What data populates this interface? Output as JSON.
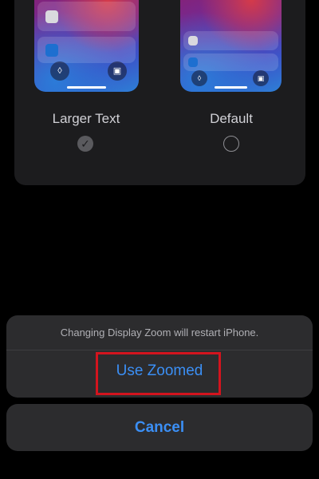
{
  "display_zoom": {
    "options": [
      {
        "label": "Larger Text",
        "selected": true
      },
      {
        "label": "Default",
        "selected": false
      }
    ],
    "preview_icons": {
      "left": "flashlight-icon",
      "right": "camera-icon"
    }
  },
  "action_sheet": {
    "message": "Changing Display Zoom will restart iPhone.",
    "primary_action": "Use Zoomed",
    "cancel": "Cancel"
  },
  "colors": {
    "accent": "#3b8ff5",
    "highlight_box": "#d3141e",
    "sheet_background": "#2c2c2e"
  }
}
